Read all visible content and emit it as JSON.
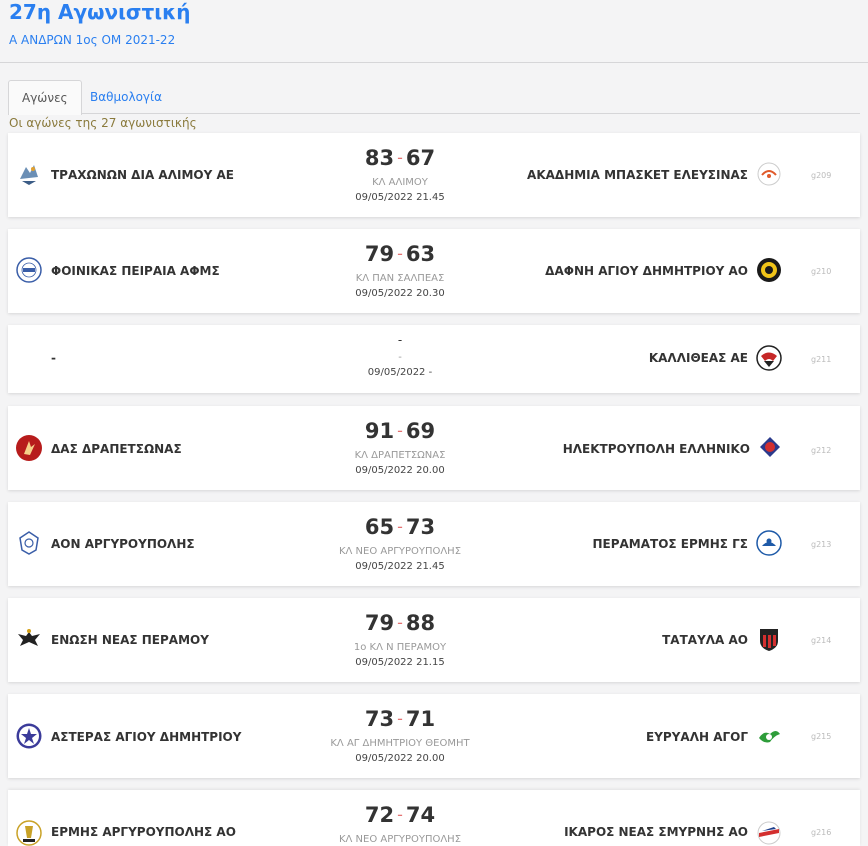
{
  "header": {
    "title": "27η Αγωνιστική",
    "subtitle": "Α ΑΝΔΡΩΝ 1ος ΟΜ 2021-22"
  },
  "tabs": [
    {
      "label": "Αγώνες"
    },
    {
      "label": "Βαθμολογία"
    }
  ],
  "list_caption": "Οι αγώνες της 27 αγωνιστικής",
  "games": [
    {
      "home": "ΤΡΑΧΩΝΩΝ ΔΙΑ ΑΛΙΜΟΥ ΑΕ",
      "home_logo": "trachones-logo-icon",
      "away": "ΑΚΑΔΗΜΙΑ ΜΠΑΣΚΕΤ ΕΛΕΥΣΙΝΑΣ",
      "away_logo": "akadimia-logo-icon",
      "home_score": "83",
      "away_score": "67",
      "venue": "ΚΛ ΑΛΙΜΟΥ",
      "datetime": "09/05/2022 21.45",
      "code": "g209"
    },
    {
      "home": "ΦΟΙΝΙΚΑΣ ΠΕΙΡΑΙΑ ΑΦΜΣ",
      "home_logo": "foinikas-logo-icon",
      "away": "ΔΑΦΝΗ ΑΓΙΟΥ ΔΗΜΗΤΡΙΟΥ ΑΟ",
      "away_logo": "dafni-logo-icon",
      "home_score": "79",
      "away_score": "63",
      "venue": "ΚΛ ΠΑΝ ΣΑΛΠΕΑΣ",
      "datetime": "09/05/2022 20.30",
      "code": "g210"
    },
    {
      "home": "-",
      "home_logo": "",
      "away": "ΚΑΛΛΙΘΕΑΣ ΑΕ",
      "away_logo": "kallithea-logo-icon",
      "home_score": "",
      "away_score": "",
      "venue": "-",
      "datetime": "09/05/2022 -",
      "code": "g211"
    },
    {
      "home": "ΔΑΣ ΔΡΑΠΕΤΣΩΝΑΣ",
      "home_logo": "das-logo-icon",
      "away": "ΗΛΕΚΤΡΟΥΠΟΛΗ ΕΛΛΗΝΙΚΟ",
      "away_logo": "ilektroupoli-logo-icon",
      "home_score": "91",
      "away_score": "69",
      "venue": "ΚΛ ΔΡΑΠΕΤΣΩΝΑΣ",
      "datetime": "09/05/2022 20.00",
      "code": "g212"
    },
    {
      "home": "ΑΟΝ ΑΡΓΥΡΟΥΠΟΛΗΣ",
      "home_logo": "aon-logo-icon",
      "away": "ΠΕΡΑΜΑΤΟΣ ΕΡΜΗΣ ΓΣ",
      "away_logo": "peramatos-logo-icon",
      "home_score": "65",
      "away_score": "73",
      "venue": "ΚΛ ΝΕΟ ΑΡΓΥΡΟΥΠΟΛΗΣ",
      "datetime": "09/05/2022 21.45",
      "code": "g213"
    },
    {
      "home": "ΕΝΩΣΗ ΝΕΑΣ ΠΕΡΑΜΟΥ",
      "home_logo": "enosi-logo-icon",
      "away": "ΤΑΤΑΥΛΑ ΑΟ",
      "away_logo": "tatavla-logo-icon",
      "home_score": "79",
      "away_score": "88",
      "venue": "1ο ΚΛ Ν ΠΕΡΑΜΟΥ",
      "datetime": "09/05/2022 21.15",
      "code": "g214"
    },
    {
      "home": "ΑΣΤΕΡΑΣ ΑΓΙΟΥ ΔΗΜΗΤΡΙΟΥ",
      "home_logo": "asteras-logo-icon",
      "away": "ΕΥΡΥΑΛΗ ΑΓΟΓ",
      "away_logo": "evryali-logo-icon",
      "home_score": "73",
      "away_score": "71",
      "venue": "ΚΛ ΑΓ ΔΗΜΗΤΡΙΟΥ ΘΕΟΜΗΤ",
      "datetime": "09/05/2022 20.00",
      "code": "g215"
    },
    {
      "home": "ΕΡΜΗΣ ΑΡΓΥΡΟΥΠΟΛΗΣ ΑΟ",
      "home_logo": "ermis-logo-icon",
      "away": "ΙΚΑΡΟΣ ΝΕΑΣ ΣΜΥΡΝΗΣ ΑΟ",
      "away_logo": "ikaros-logo-icon",
      "home_score": "72",
      "away_score": "74",
      "venue": "ΚΛ ΝΕΟ ΑΡΓΥΡΟΥΠΟΛΗΣ",
      "datetime": "",
      "code": "g216"
    }
  ],
  "colors": {
    "accent": "#2a7ff0",
    "score_dash": "#e57373"
  }
}
